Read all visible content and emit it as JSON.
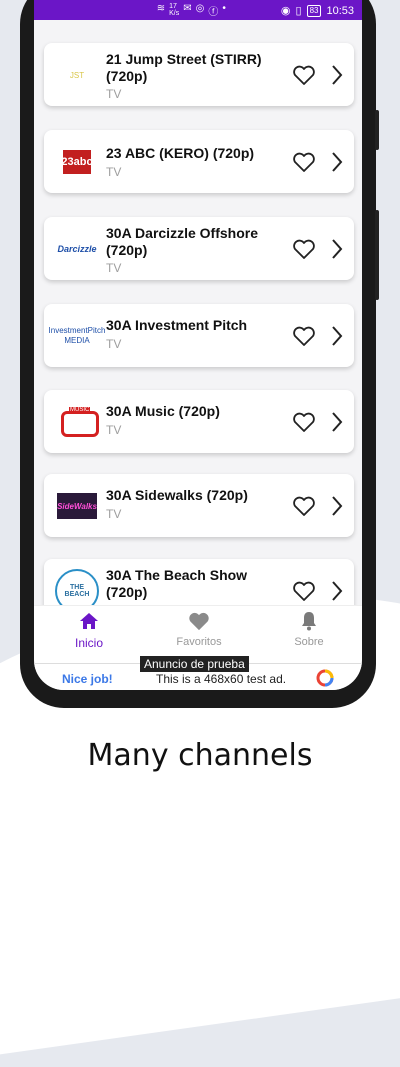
{
  "status_bar": {
    "left": "",
    "net_speed": "17\nK/s",
    "battery": "83",
    "time": "10:53"
  },
  "channels": [
    {
      "title": "21 Jump Street (STIRR) (720p)",
      "subtitle": "TV",
      "logo_text": "JST"
    },
    {
      "title": "23 ABC (KERO) (720p)",
      "subtitle": "TV",
      "logo_text": "23abc"
    },
    {
      "title": "30A Darcizzle Offshore (720p)",
      "subtitle": "TV",
      "logo_text": "Darcizzle"
    },
    {
      "title": "30A Investment Pitch",
      "subtitle": "TV",
      "logo_text": "InvestmentPitch MEDIA"
    },
    {
      "title": "30A Music (720p)",
      "subtitle": "TV",
      "logo_text": "MUSIC"
    },
    {
      "title": "30A Sidewalks (720p)",
      "subtitle": "TV",
      "logo_text": "SideWalks"
    },
    {
      "title": "30A The Beach Show (720p)",
      "subtitle": "TV",
      "logo_text": "THE BEACH"
    }
  ],
  "bottom_nav": [
    {
      "label": "Inicio",
      "icon": "home-icon"
    },
    {
      "label": "Favoritos",
      "icon": "heart-icon"
    },
    {
      "label": "Sobre",
      "icon": "bell-icon"
    }
  ],
  "ad": {
    "label": "Anuncio de prueba",
    "nice": "Nice job!",
    "text": "This is a 468x60 test ad."
  },
  "caption": "Many channels",
  "colors": {
    "accent": "#6b16c7",
    "muted": "#9e9e9e"
  }
}
